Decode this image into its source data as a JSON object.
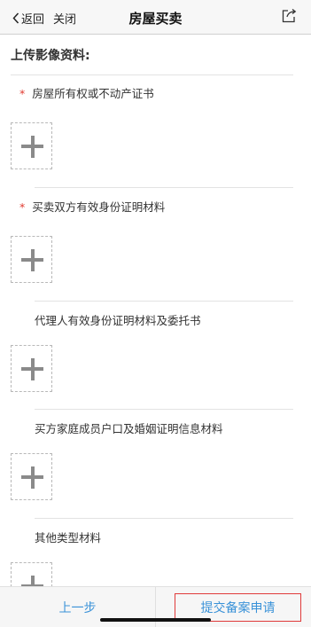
{
  "nav": {
    "back_label": "返回",
    "close_label": "关闭",
    "title": "房屋买卖"
  },
  "section": {
    "title": "上传影像资料:"
  },
  "items": [
    {
      "required": true,
      "star": "*",
      "label": "房屋所有权或不动产证书"
    },
    {
      "required": true,
      "star": "*",
      "label": "买卖双方有效身份证明材料"
    },
    {
      "required": false,
      "star": "",
      "label": "代理人有效身份证明材料及委托书"
    },
    {
      "required": false,
      "star": "",
      "label": "买方家庭成员户口及婚姻证明信息材料"
    },
    {
      "required": false,
      "star": "",
      "label": "其他类型材料"
    }
  ],
  "footer": {
    "prev_label": "上一步",
    "submit_label": "提交备案申请"
  },
  "colors": {
    "required_star": "#e0392f",
    "button_text": "#3a92d8",
    "submit_outline": "#e03a3a"
  },
  "icons": {
    "back": "chevron-left-icon",
    "share": "share-icon",
    "upload": "plus-icon"
  }
}
